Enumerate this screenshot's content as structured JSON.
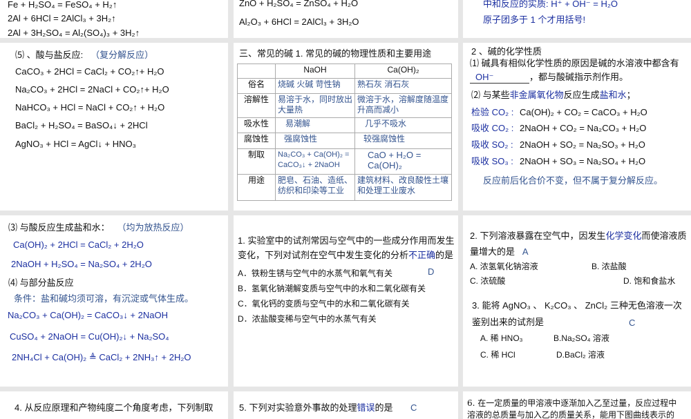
{
  "s1": {
    "lines": [
      "Fe + H₂SO₄ = FeSO₄ + H₂↑",
      "2Al +  6HCl = 2AlCl₃ + 3H₂↑",
      "2Al +  3H₂SO₄ = Al₂(SO₄)₃ + 3H₂↑"
    ]
  },
  "s2": {
    "lines": [
      "ZnO +  H₂SO₄ = ZnSO₄ + H₂O",
      "Al₂O₃ +  6HCl = 2AlCl₃ + 3H₂O"
    ]
  },
  "s3": {
    "lines": [
      "中和反应的实质:  H⁺ + OH⁻ = H₂O",
      "原子团多于 1 个才用括号!"
    ]
  },
  "s4": {
    "title": "⑸ 、酸与盐反应:",
    "note": "（复分解反应）",
    "lines": [
      "CaCO₃ + 2HCl = CaCl₂ + CO₂↑+ H₂O",
      "Na₂CO₃ + 2HCl = 2NaCl + CO₂↑+ H₂O",
      "NaHCO₃ + HCl = NaCl + CO₂↑ + H₂O",
      "BaCl₂ + H₂SO₄ = BaSO₄↓ + 2HCl",
      "AgNO₃ + HCl = AgCl↓ + HNO₃"
    ]
  },
  "s5": {
    "heading": "三、常见的碱     1. 常见的碱的物理性质和主要用途",
    "table": {
      "headers": [
        "",
        "NaOH",
        "Ca(OH)₂"
      ],
      "rows": [
        [
          "俗名",
          "烧碱  火碱  苛性钠",
          "熟石灰   消石灰"
        ],
        [
          "溶解性",
          "易溶于水，同时放出大量热",
          "微溶于水，溶解度随温度升高而减小"
        ],
        [
          "吸水性",
          "易潮解",
          "几乎不吸水"
        ],
        [
          "腐蚀性",
          "强腐蚀性",
          "较强腐蚀性"
        ],
        [
          "制取",
          "Na₂CO₃ + Ca(OH)₂ = CaCO₃↓ + 2NaOH",
          "CaO + H₂O = Ca(OH)₂"
        ],
        [
          "用途",
          "肥皂、石油、造纸、纺织和印染等工业",
          "建筑材料、改良酸性土壤和处理工业废水"
        ]
      ]
    }
  },
  "s6": {
    "title": "2 、碱的化学性质",
    "p1": "⑴ 碱具有相似化学性质的原因是碱的水溶液中都含有",
    "blank": "OH⁻",
    "p1_end": "，都与酸碱指示剂作用。",
    "p2_a": "⑵ 与某些",
    "p2_b": "非金属氧化物",
    "p2_c": "反应生成",
    "p2_d": "盐和水",
    "p2_e": "；",
    "rows": [
      {
        "label": "检验 CO₂ :",
        "eq": "Ca(OH)₂ + CO₂ = CaCO₃ + H₂O"
      },
      {
        "label": "吸收 CO₂ :",
        "eq": "2NaOH + CO₂ = Na₂CO₃ + H₂O"
      },
      {
        "label": "吸收 SO₂ :",
        "eq": "2NaOH + SO₂ = Na₂SO₃ + H₂O"
      },
      {
        "label": "吸收 SO₃ :",
        "eq": "2NaOH + SO₃ = Na₂SO₄ + H₂O"
      }
    ],
    "note": "反应前后化合价不变，但不属于复分解反应。"
  },
  "s7": {
    "t3": "⑶ 与酸反应生成盐和水：",
    "t3_note": "（均为放热反应）",
    "eq3": [
      "Ca(OH)₂ + 2HCl = CaCl₂ + 2H₂O",
      "2NaOH + H₂SO₄ = Na₂SO₄ + 2H₂O"
    ],
    "t4": "⑷ 与部分盐反应",
    "cond": "条件：盐和碱均须可溶，有沉淀或气体生成。",
    "eq4": [
      "Na₂CO₃ + Ca(OH)₂ = CaCO₃↓ + 2NaOH",
      "CuSO₄ + 2NaOH = Cu(OH)₂↓ + Na₂SO₄",
      "2NH₄Cl + Ca(OH)₂ ≜ CaCl₂ + 2NH₃↑ + 2H₂O"
    ]
  },
  "s8": {
    "q1": "1. 实验室中的试剂常因与空气中的一些成分作用而发生",
    "q2a": "变化，下列对试剂在空气中发生变化的分析",
    "q2b": "不正确",
    "q2c": "的是",
    "answer": "D",
    "options": [
      "A．铁粉生锈与空气中的水蒸气和氧气有关",
      "B．氢氧化钠潮解变质与空气中的水和二氧化碳有关",
      "C．氧化钙的变质与空气中的水和二氧化碳有关",
      "D．浓盐酸变稀与空气中的水蒸气有关"
    ]
  },
  "s9": {
    "q2a": "2. 下列溶液暴露在空气中，因发生",
    "q2b": "化学变化",
    "q2c": "而使溶液质",
    "q2d": "量增大的是",
    "q2_answer": "A",
    "q2_opts": [
      "A. 浓氢氧化钠溶液",
      "B. 浓盐酸",
      "C. 浓硫酸",
      "D. 饱和食盐水"
    ],
    "q3a": "3. 能将 AgNO₃ 、 K₂CO₃ 、 ZnCl₂ 三种无色溶液一次",
    "q3b": "鉴别出来的试剂是",
    "q3_answer": "C",
    "q3_opts": [
      "A. 稀 HNO₃",
      "B.Na₂SO₄ 溶液",
      "C. 稀 HCl",
      "D.BaCl₂ 溶液"
    ]
  },
  "s10": {
    "text": "4. 从反应原理和产物纯度二个角度考虑，下列制取"
  },
  "s11": {
    "text_a": "5. 下列对实验意外事故的处理",
    "text_b": "错误",
    "text_c": "的是",
    "answer": "C"
  },
  "s12": {
    "l1": "6. 在一定质量的甲溶液中逐渐加入乙至过量，反应过程中",
    "l2": "溶液的总质量与加入乙的质量关系，能用下图曲线表示的"
  }
}
